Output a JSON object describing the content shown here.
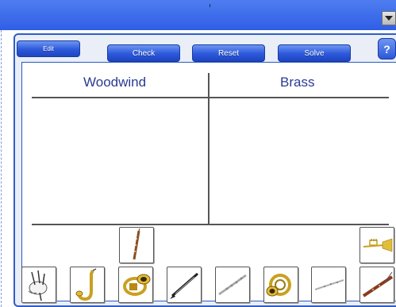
{
  "toolbar": {
    "edit_label": "Edit",
    "check_label": "Check",
    "reset_label": "Reset",
    "solve_label": "Solve",
    "help_label": "?"
  },
  "columns": {
    "left_title": "Woodwind",
    "right_title": "Brass"
  },
  "cards": [
    {
      "name": "oboe-card",
      "icon": "oboe-icon"
    },
    {
      "name": "bagpipe-card",
      "icon": "bagpipe-icon"
    },
    {
      "name": "saxophone-card",
      "icon": "saxophone-icon"
    },
    {
      "name": "sousaphone-card",
      "icon": "sousaphone-icon"
    },
    {
      "name": "clarinet-card",
      "icon": "clarinet-icon"
    },
    {
      "name": "flute-silver-card",
      "icon": "flute-icon"
    },
    {
      "name": "french-horn-card",
      "icon": "french-horn-icon"
    },
    {
      "name": "piccolo-card",
      "icon": "piccolo-icon"
    },
    {
      "name": "trumpet-card",
      "icon": "trumpet-icon"
    },
    {
      "name": "bassoon-card",
      "icon": "bassoon-icon"
    }
  ],
  "colors": {
    "accent": "#2c58da",
    "title_text": "#2a3b92",
    "brass_gold": "#c9a020"
  }
}
